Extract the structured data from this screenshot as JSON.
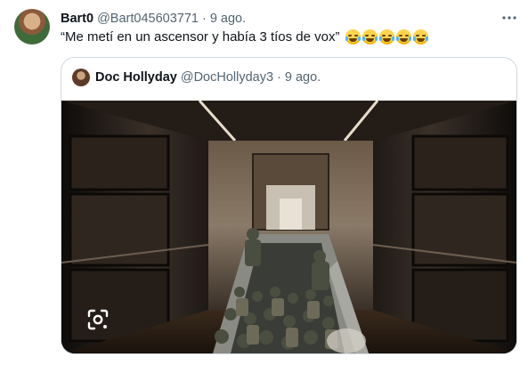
{
  "tweet": {
    "author_name": "Bart0",
    "author_handle": "@Bart045603771",
    "separator": "·",
    "time": "9 ago.",
    "text": "“Me metí en un ascensor y había 3 tíos de vox”",
    "emoji_count": 5,
    "more_icon": "more-horizontal-icon"
  },
  "quoted_tweet": {
    "author_name": "Doc Hollyday",
    "author_handle": "@DocHollyday3",
    "separator": "·",
    "time": "9 ago.",
    "media": {
      "description_icon": "image",
      "overlay_icon": "google-lens-icon"
    }
  },
  "colors": {
    "text": "#0f1419",
    "muted": "#536471",
    "border": "#cfd9de"
  }
}
